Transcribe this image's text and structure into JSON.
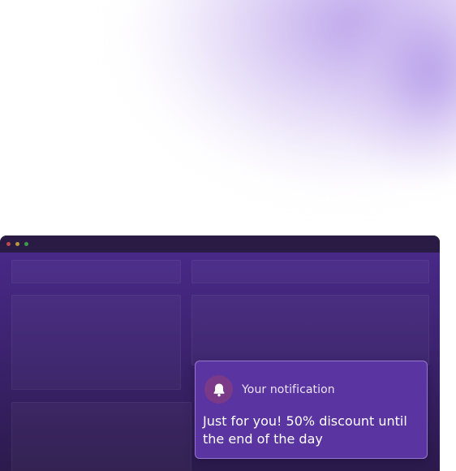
{
  "window": {
    "controls": [
      "close",
      "minimize",
      "maximize"
    ]
  },
  "notification": {
    "icon": "bell-icon",
    "title": "Your notification",
    "message": "Just for you! 50% discount until the end of the day"
  },
  "colors": {
    "window_bg": "#3d2370",
    "titlebar_bg": "#2a1b45",
    "toast_bg": "#5a34a0",
    "icon_bg": "#7a3a88",
    "glow": "#b296e8"
  }
}
